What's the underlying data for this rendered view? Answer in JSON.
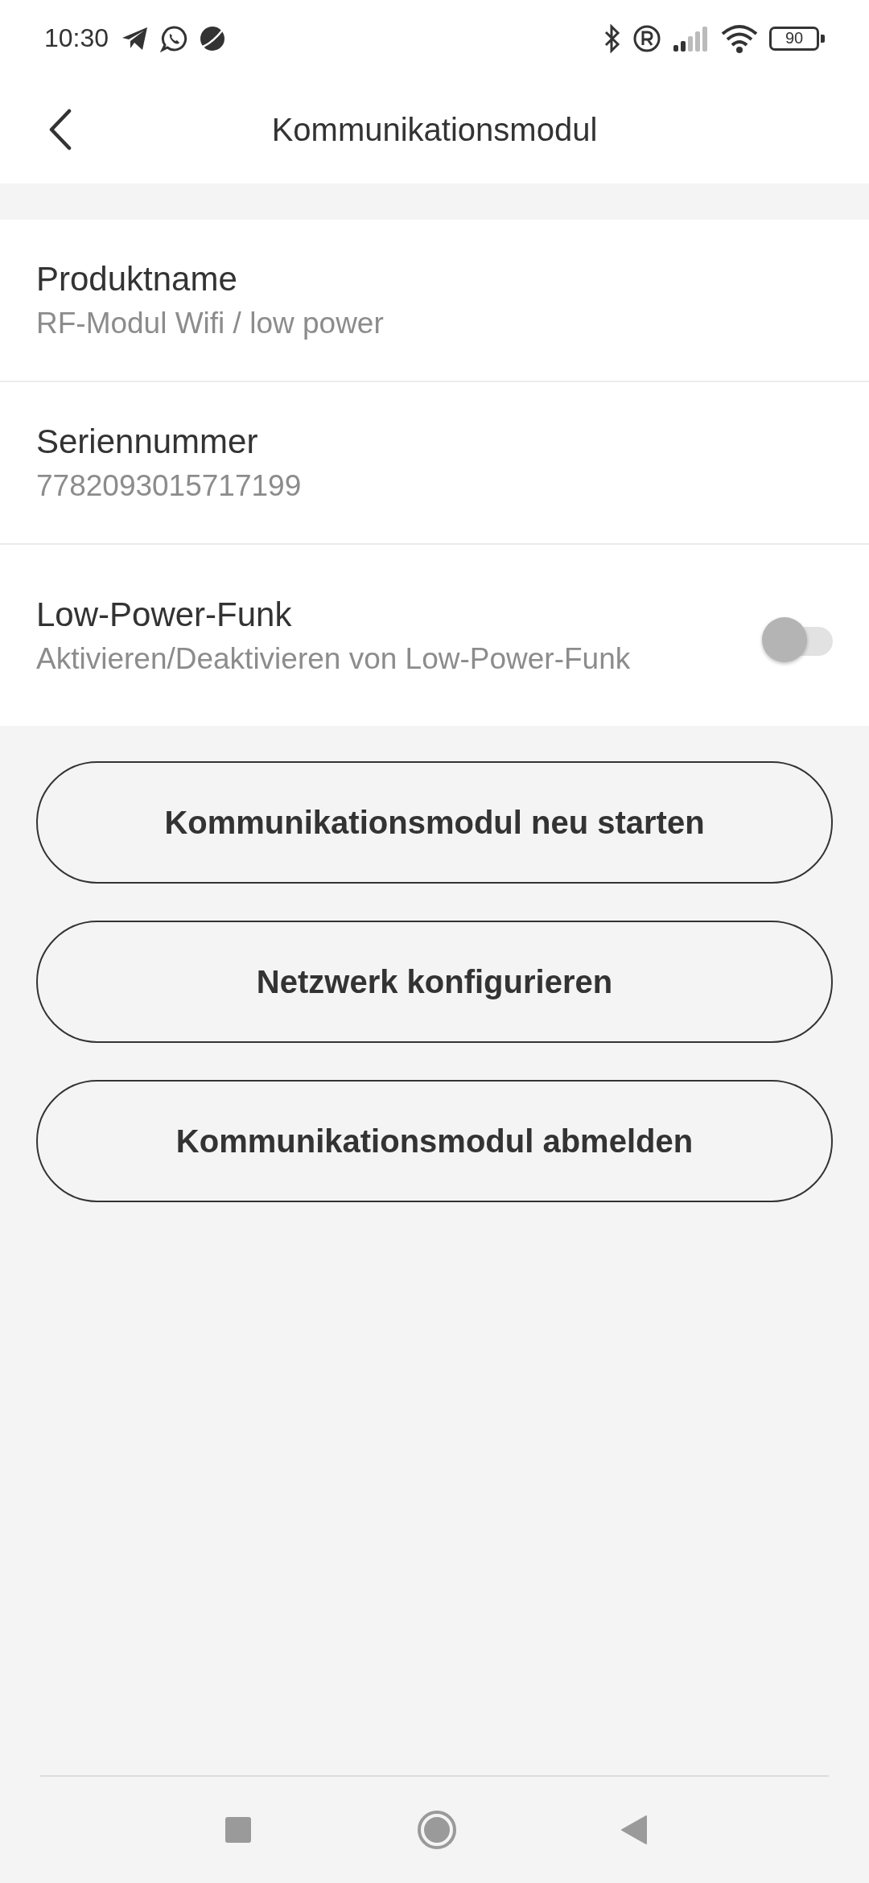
{
  "status_bar": {
    "time": "10:30",
    "battery": "90"
  },
  "header": {
    "title": "Kommunikationsmodul"
  },
  "rows": [
    {
      "kind": "info",
      "title": "Produktname",
      "subtitle": "RF-Modul Wifi / low power"
    },
    {
      "kind": "info",
      "title": "Seriennummer",
      "subtitle": "7782093015717199"
    },
    {
      "kind": "switch",
      "title": "Low-Power-Funk",
      "subtitle": "Aktivieren/Deaktivieren von Low-Power-Funk",
      "on": false
    }
  ],
  "buttons": [
    "Kommunikationsmodul neu starten",
    "Netzwerk konfigurieren",
    "Kommunikationsmodul abmelden"
  ]
}
